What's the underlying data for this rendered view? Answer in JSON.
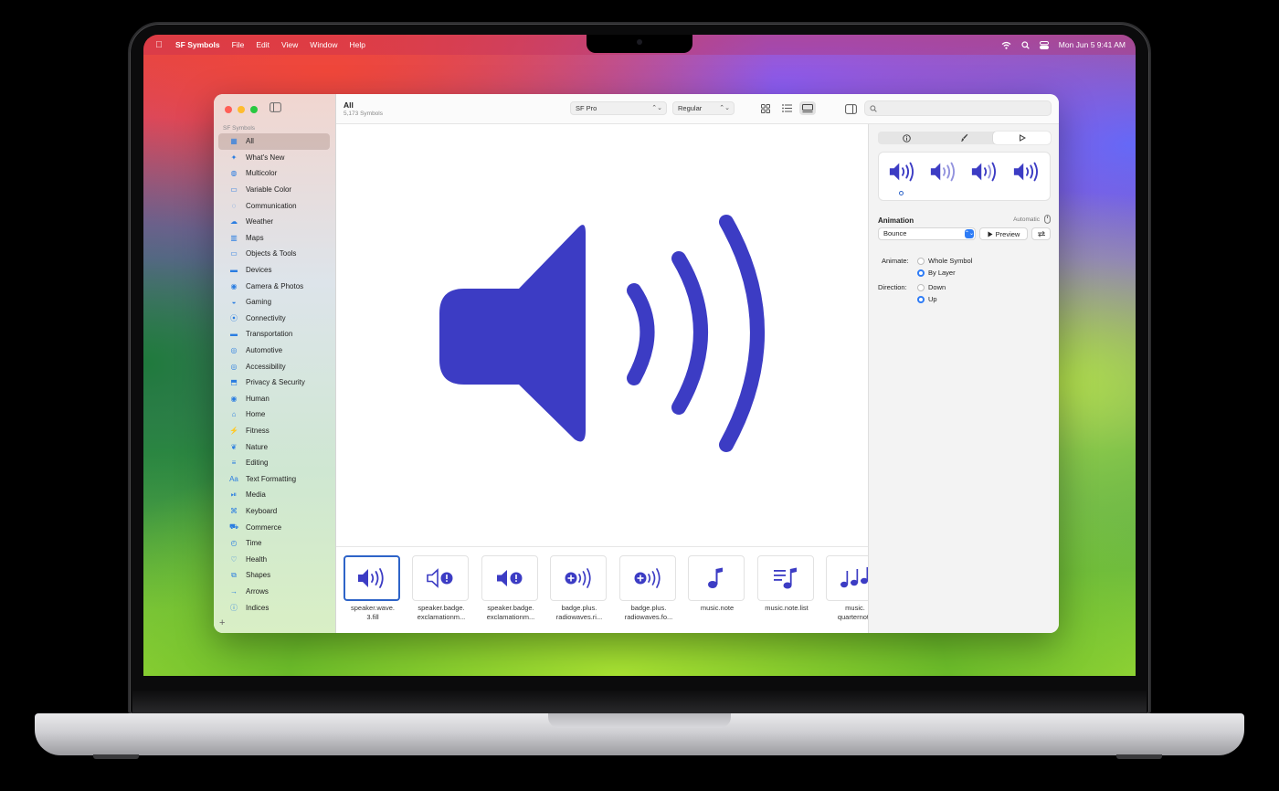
{
  "menubar": {
    "apple_icon": "apple-logo-icon",
    "app_name": "SF Symbols",
    "menus": [
      "File",
      "Edit",
      "View",
      "Window",
      "Help"
    ],
    "status_icons": [
      "wifi-icon",
      "search-icon",
      "control-center-icon"
    ],
    "clock": "Mon Jun 5  9:41 AM"
  },
  "sidebar": {
    "section_title": "SF Symbols",
    "items": [
      {
        "label": "All",
        "icon": "grid-icon",
        "glyph": "▦"
      },
      {
        "label": "What's New",
        "icon": "sparkles-icon",
        "glyph": "✦"
      },
      {
        "label": "Multicolor",
        "icon": "paintpalette-icon",
        "glyph": "◍"
      },
      {
        "label": "Variable Color",
        "icon": "slider-icon",
        "glyph": "▭"
      },
      {
        "label": "Communication",
        "icon": "bubble-icon",
        "glyph": "◌"
      },
      {
        "label": "Weather",
        "icon": "cloud-icon",
        "glyph": "☁"
      },
      {
        "label": "Maps",
        "icon": "map-icon",
        "glyph": "▥"
      },
      {
        "label": "Objects & Tools",
        "icon": "folder-icon",
        "glyph": "▭"
      },
      {
        "label": "Devices",
        "icon": "desktop-icon",
        "glyph": "▬"
      },
      {
        "label": "Camera & Photos",
        "icon": "camera-icon",
        "glyph": "◉"
      },
      {
        "label": "Gaming",
        "icon": "gamecontroller-icon",
        "glyph": "◒"
      },
      {
        "label": "Connectivity",
        "icon": "antenna-icon",
        "glyph": "⦿"
      },
      {
        "label": "Transportation",
        "icon": "car-icon",
        "glyph": "▬"
      },
      {
        "label": "Automotive",
        "icon": "steering-icon",
        "glyph": "◎"
      },
      {
        "label": "Accessibility",
        "icon": "accessibility-icon",
        "glyph": "◎"
      },
      {
        "label": "Privacy & Security",
        "icon": "lock-icon",
        "glyph": "⬒"
      },
      {
        "label": "Human",
        "icon": "person-icon",
        "glyph": "◉"
      },
      {
        "label": "Home",
        "icon": "house-icon",
        "glyph": "⌂"
      },
      {
        "label": "Fitness",
        "icon": "figure-run-icon",
        "glyph": "⚡"
      },
      {
        "label": "Nature",
        "icon": "leaf-icon",
        "glyph": "❦"
      },
      {
        "label": "Editing",
        "icon": "slider-horizontal-icon",
        "glyph": "≡"
      },
      {
        "label": "Text Formatting",
        "icon": "textformat-icon",
        "glyph": "Aa"
      },
      {
        "label": "Media",
        "icon": "playpause-icon",
        "glyph": "⏯"
      },
      {
        "label": "Keyboard",
        "icon": "command-icon",
        "glyph": "⌘"
      },
      {
        "label": "Commerce",
        "icon": "cart-icon",
        "glyph": "⛟"
      },
      {
        "label": "Time",
        "icon": "clock-icon",
        "glyph": "◴"
      },
      {
        "label": "Health",
        "icon": "heart-icon",
        "glyph": "♡"
      },
      {
        "label": "Shapes",
        "icon": "square-on-square-icon",
        "glyph": "⧉"
      },
      {
        "label": "Arrows",
        "icon": "arrow-right-icon",
        "glyph": "→"
      },
      {
        "label": "Indices",
        "icon": "info-circle-icon",
        "glyph": "ⓘ"
      }
    ],
    "add_label": "+"
  },
  "toolbar": {
    "title": "All",
    "count": "5,173 Symbols",
    "font_popup": "SF Pro",
    "weight_popup": "Regular",
    "popup_arrows": "⌃⌄",
    "view_buttons": [
      "grid-view-icon",
      "list-view-icon",
      "gallery-view-icon"
    ],
    "search_placeholder": ""
  },
  "main": {
    "symbol": "speaker.wave.3.fill",
    "symbol_color": "#3c3cc4"
  },
  "strip": {
    "tiles": [
      {
        "label": "speaker.wave.\n3.fill",
        "icon": "speaker-wave-3-fill-icon"
      },
      {
        "label": "speaker.badge.\nexclamationm...",
        "icon": "speaker-badge-exclamationmark-icon"
      },
      {
        "label": "speaker.badge.\nexclamationm...",
        "icon": "speaker-badge-exclamationmark-fill-icon"
      },
      {
        "label": "badge.plus.\nradiowaves.ri...",
        "icon": "badge-plus-radiowaves-right-icon"
      },
      {
        "label": "badge.plus.\nradiowaves.fo...",
        "icon": "badge-plus-radiowaves-forward-icon"
      },
      {
        "label": "music.note",
        "icon": "music-note-icon"
      },
      {
        "label": "music.note.list",
        "icon": "music-note-list-icon"
      },
      {
        "label": "music.\nquarternote",
        "icon": "music-quarternote-icon"
      }
    ]
  },
  "inspector": {
    "segments": [
      "info-icon",
      "paintbrush-icon",
      "play-icon"
    ],
    "animation_title": "Animation",
    "animation_mode": "Automatic",
    "animation_effect": "Bounce",
    "preview_label": "Preview",
    "animate_label": "Animate:",
    "animate_options": [
      "Whole Symbol",
      "By Layer"
    ],
    "animate_selected": "By Layer",
    "direction_label": "Direction:",
    "direction_options": [
      "Down",
      "Up"
    ],
    "direction_selected": "Up"
  },
  "colors": {
    "accent": "#2e7cf6",
    "symbol": "#3c3cc4"
  }
}
